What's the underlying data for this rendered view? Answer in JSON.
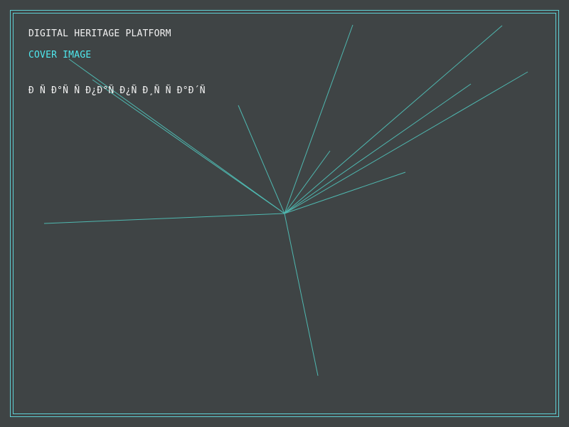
{
  "header": {
    "title": "DIGITAL HERITAGE PLATFORM",
    "subtitle": "COVER IMAGE",
    "caption": "Ð Ñ Ð°Ñ Ñ Ð¿Ð°Ñ  Ð¿Ñ Ð¸Ñ Ñ Ð°Ð´Ñ"
  },
  "colors": {
    "background": "#3f4445",
    "frame": "#5fd0d4",
    "rays": "#4fb8b0",
    "title": "#f2f2f2",
    "subtitle": "#4fe8ee"
  }
}
